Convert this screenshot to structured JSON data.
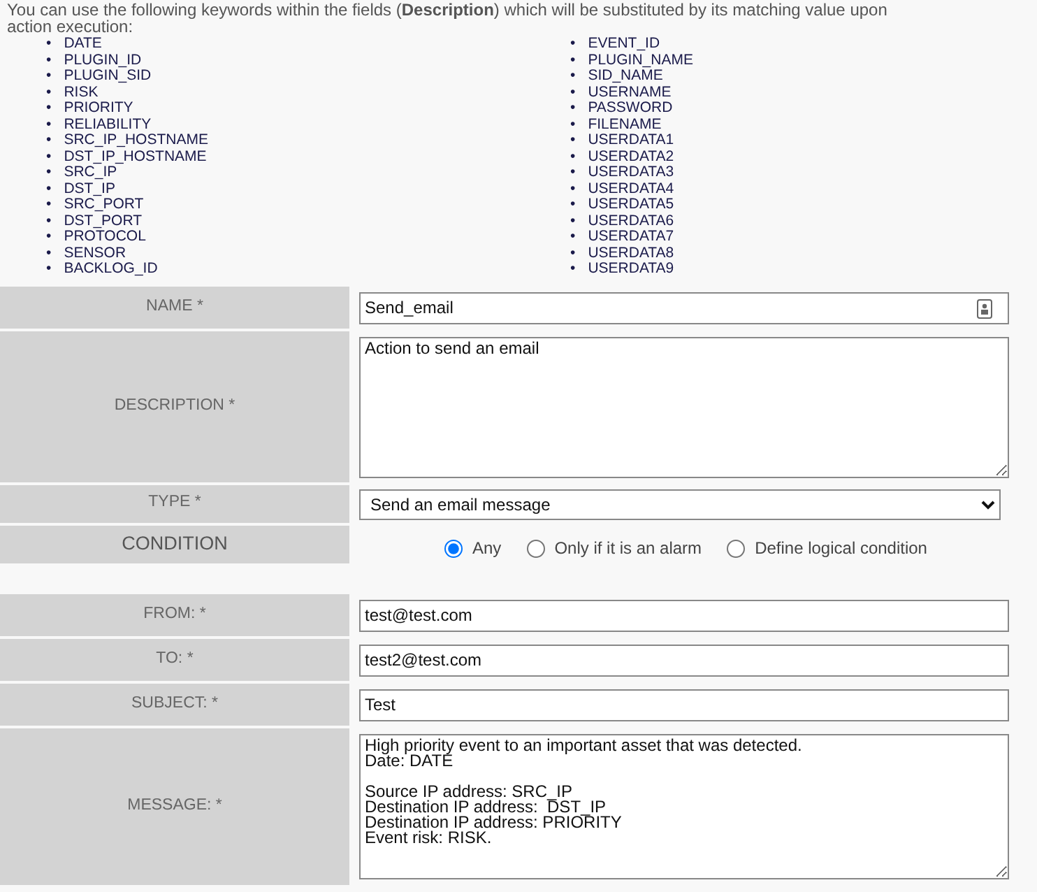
{
  "intro": "You can use the following keywords within the fields (**Description**) which will be substituted by its matching value upon action execution:",
  "keywords": {
    "marker": "•",
    "left": [
      "DATE",
      "PLUGIN_ID",
      "PLUGIN_SID",
      "RISK",
      "PRIORITY",
      "RELIABILITY",
      "SRC_IP_HOSTNAME",
      "DST_IP_HOSTNAME",
      "SRC_IP",
      "DST_IP",
      "SRC_PORT",
      "DST_PORT",
      "PROTOCOL",
      "SENSOR",
      "BACKLOG_ID"
    ],
    "right": [
      "EVENT_ID",
      "PLUGIN_NAME",
      "SID_NAME",
      "USERNAME",
      "PASSWORD",
      "FILENAME",
      "USERDATA1",
      "USERDATA2",
      "USERDATA3",
      "USERDATA4",
      "USERDATA5",
      "USERDATA6",
      "USERDATA7",
      "USERDATA8",
      "USERDATA9"
    ]
  },
  "form": [
    {
      "kind": "text",
      "label": "NAME *",
      "value": "Send_email",
      "contact_icon": true
    },
    {
      "kind": "textarea",
      "label": "DESCRIPTION *",
      "value": "Action to send an email"
    },
    {
      "kind": "select",
      "label": "TYPE *",
      "value": "Send an email message"
    },
    {
      "kind": "radio",
      "label": "CONDITION",
      "options": [
        {
          "label": "Any",
          "selected": true
        },
        {
          "label": "Only if it is an alarm",
          "selected": false
        },
        {
          "label": "Define logical condition",
          "selected": false
        }
      ]
    },
    {
      "kind": "spacer"
    },
    {
      "kind": "text",
      "label": "FROM: *",
      "value": "test@test.com"
    },
    {
      "kind": "text",
      "label": "TO: *",
      "value": "test2@test.com"
    },
    {
      "kind": "text",
      "label": "SUBJECT: *",
      "value": "Test"
    },
    {
      "kind": "message",
      "label": "MESSAGE: *",
      "value": "High priority event to an important asset that was detected.\nDate: DATE\n\nSource IP address: SRC_IP\nDestination IP address:  DST_IP\nDestination IP address: PRIORITY\nEvent risk: RISK."
    }
  ]
}
